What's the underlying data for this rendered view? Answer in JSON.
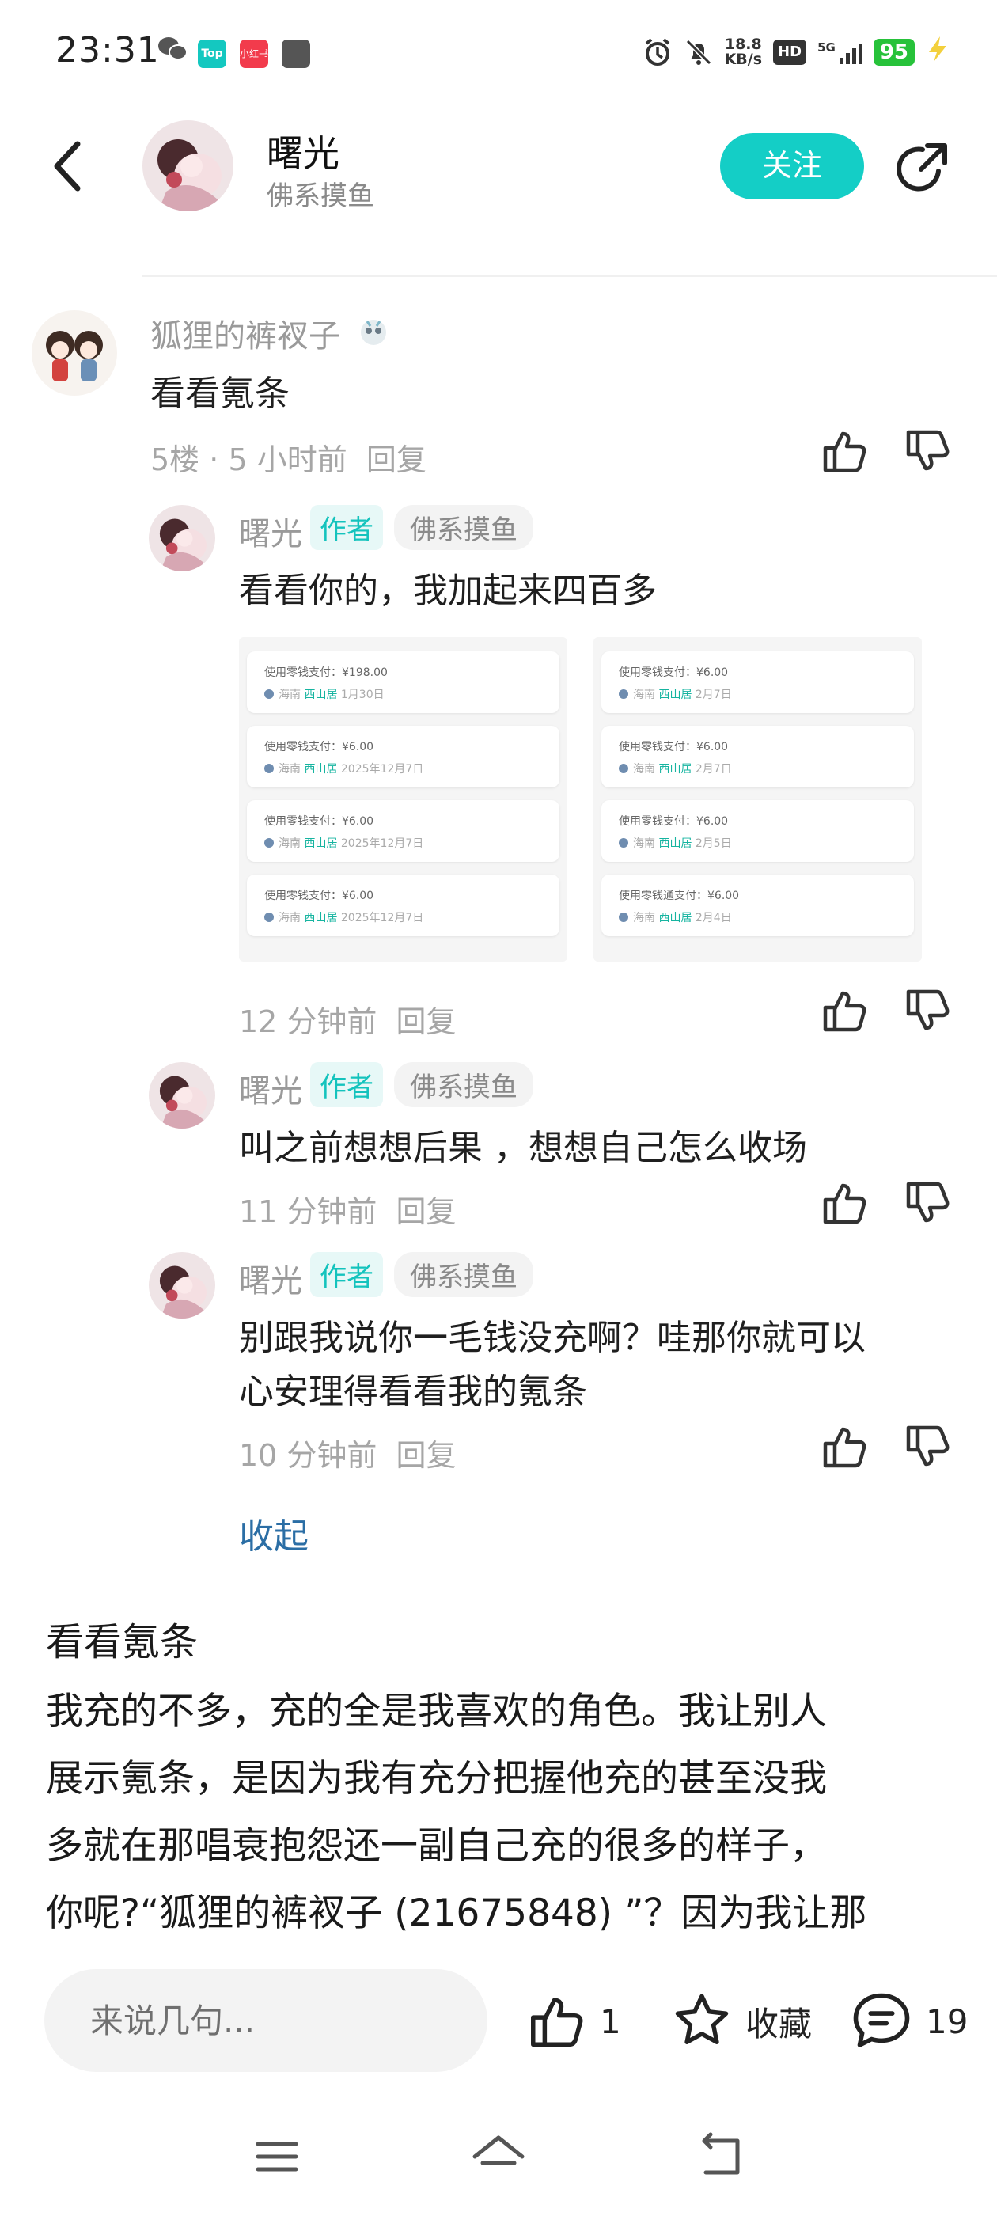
{
  "status_bar": {
    "time": "23:31",
    "notification_icons": [
      "wechat-icon",
      "top-app-icon",
      "xiaohongshu-icon",
      "app-icon"
    ],
    "top_badge": "Top",
    "red_badge": "小红书",
    "net_speed_value": "18.8",
    "net_speed_unit": "KB/s",
    "hd": "HD",
    "network": "5G",
    "battery": "95",
    "colors": {
      "battery": "#27c23a",
      "top_badge": "#14c8c0",
      "red_badge": "#f23b4c"
    }
  },
  "header": {
    "name": "曙光",
    "subtitle": "佛系摸鱼",
    "follow_label": "关注",
    "colors": {
      "follow": "#14cec6"
    }
  },
  "comment": {
    "author": "狐狸的裤衩子",
    "text": "看看氪条",
    "floor": "5楼",
    "separator": "·",
    "time": "5 小时前",
    "reply_label": "回复"
  },
  "replies": [
    {
      "author": "曙光",
      "author_tag": "作者",
      "signature": "佛系摸鱼",
      "text": "看看你的，我加起来四百多",
      "time": "12 分钟前",
      "reply_label": "回复"
    },
    {
      "author": "曙光",
      "author_tag": "作者",
      "signature": "佛系摸鱼",
      "text": "叫之前想想后果 ，想想自己怎么收场",
      "time": "11 分钟前",
      "reply_label": "回复"
    },
    {
      "author": "曙光",
      "author_tag": "作者",
      "signature": "佛系摸鱼",
      "text_line1": "别跟我说你一毛钱没充啊？哇那你就可以",
      "text_line2": "心安理得看看我的氪条",
      "time": "10 分钟前",
      "reply_label": "回复"
    }
  ],
  "screenshots": {
    "left": [
      {
        "amount": "使用零钱支付：¥198.00",
        "shop": "海南",
        "loc": "西山居",
        "date": "1月30日"
      },
      {
        "amount": "使用零钱支付：¥6.00",
        "shop": "海南",
        "loc": "西山居",
        "date": "2025年12月7日"
      },
      {
        "amount": "使用零钱支付：¥6.00",
        "shop": "海南",
        "loc": "西山居",
        "date": "2025年12月7日"
      },
      {
        "amount": "使用零钱支付：¥6.00",
        "shop": "海南",
        "loc": "西山居",
        "date": "2025年12月7日"
      }
    ],
    "right": [
      {
        "amount": "使用零钱支付：¥6.00",
        "shop": "海南",
        "loc": "西山居",
        "date": "2月7日"
      },
      {
        "amount": "使用零钱支付：¥6.00",
        "shop": "海南",
        "loc": "西山居",
        "date": "2月7日"
      },
      {
        "amount": "使用零钱支付：¥6.00",
        "shop": "海南",
        "loc": "西山居",
        "date": "2月5日"
      },
      {
        "amount": "使用零钱通支付：¥6.00",
        "shop": "海南",
        "loc": "西山居",
        "date": "2月4日"
      }
    ]
  },
  "collapse_label": "收起",
  "post": {
    "title": "看看氪条",
    "body_lines": [
      "我充的不多，充的全是我喜欢的角色。我让别人",
      "展示氪条，是因为我有充分把握他充的甚至没我",
      "多就在那唱衰抱怨还一副自己充的很多的样子，",
      "你呢?“狐狸的裤衩子 (21675848) ”？因为我让那"
    ]
  },
  "bottom_bar": {
    "input_placeholder": "来说几句...",
    "like_count": "1",
    "favorite_label": "收藏",
    "comment_count": "19"
  },
  "nav": {
    "icons": [
      "menu-icon",
      "home-icon",
      "back-nav-icon"
    ]
  }
}
